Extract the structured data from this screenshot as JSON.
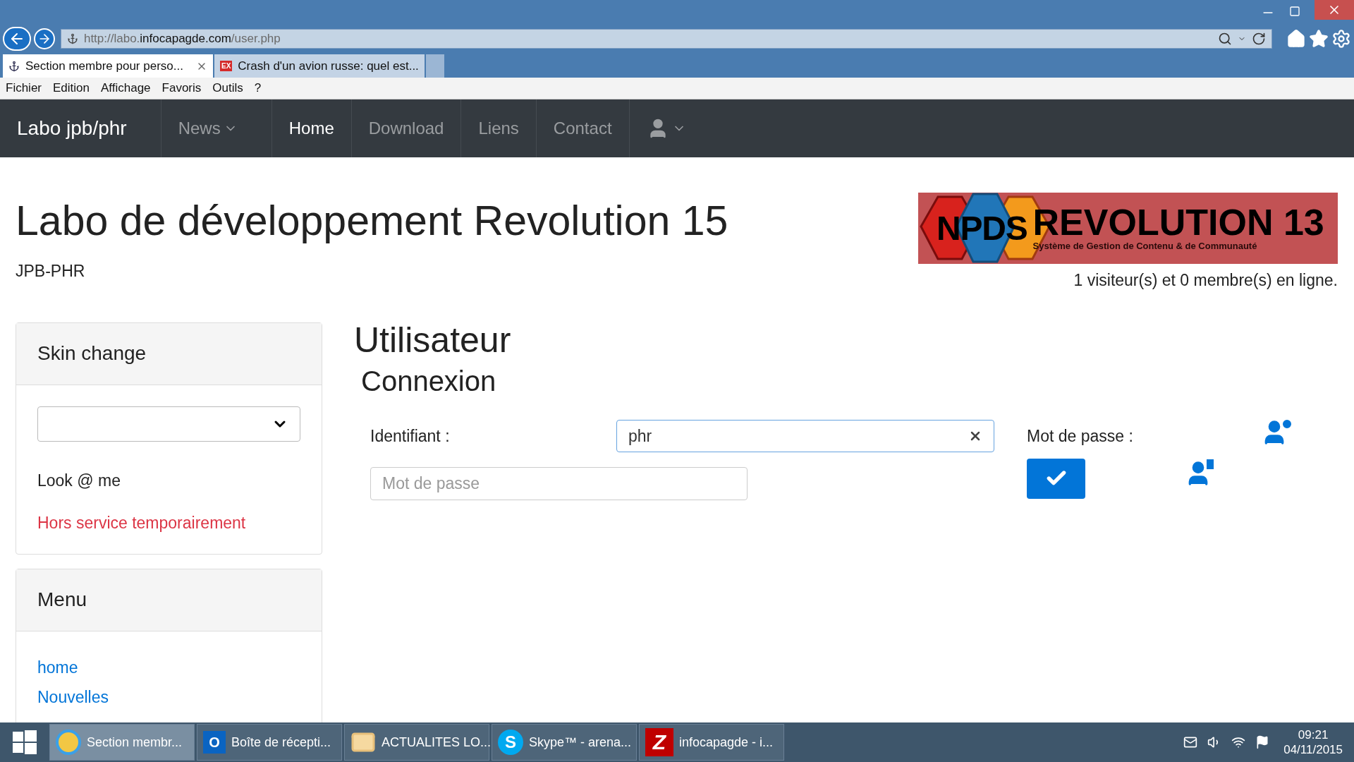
{
  "browser": {
    "address": {
      "prefix": "http://labo.",
      "domain": "infocapagde.com",
      "path": "/user.php"
    },
    "tabs": [
      {
        "label": "Section membre pour perso...",
        "selected": true,
        "kind": "anchor"
      },
      {
        "label": "Crash d'un avion russe: quel est...",
        "selected": false,
        "kind": "ex"
      }
    ],
    "ex_badge": "EX",
    "menu": [
      "Fichier",
      "Edition",
      "Affichage",
      "Favoris",
      "Outils",
      "?"
    ]
  },
  "navbar": {
    "brand": "Labo jpb/phr",
    "items": [
      {
        "label": "News",
        "dropdown": true,
        "selected": false
      },
      {
        "label": "Home",
        "dropdown": false,
        "selected": true
      },
      {
        "label": "Download",
        "dropdown": false,
        "selected": false
      },
      {
        "label": "Liens",
        "dropdown": false,
        "selected": false
      },
      {
        "label": "Contact",
        "dropdown": false,
        "selected": false
      }
    ]
  },
  "header": {
    "title": "Labo de développement Revolution 15",
    "subtitle": "JPB-PHR",
    "logo": {
      "npds": "NPDS",
      "name": "REVOLUTION 13",
      "tagline": "Système de Gestion de Contenu & de Communauté"
    },
    "online": "1 visiteur(s) et 0 membre(s) en ligne."
  },
  "sidebar": [
    {
      "title": "Skin change",
      "kind": "skin",
      "text": "Look @ me",
      "warning": "Hors service temporairement"
    },
    {
      "title": "Menu",
      "kind": "links",
      "links": [
        "home",
        "Nouvelles"
      ]
    }
  ],
  "main": {
    "title": "Utilisateur",
    "subtitle": "Connexion",
    "login_label": "Identifiant :",
    "login_value": "phr",
    "password_placeholder": "Mot de passe",
    "password_label": "Mot de passe :"
  },
  "taskbar": {
    "items": [
      {
        "label": "Section membr...",
        "kind": "ie",
        "selected": true
      },
      {
        "label": "Boîte de récepti...",
        "kind": "outlook",
        "selected": false
      },
      {
        "label": "ACTUALITES LO...",
        "kind": "mail",
        "selected": false
      },
      {
        "label": "Skype™ - arena...",
        "kind": "skype",
        "selected": false
      },
      {
        "label": "infocapagde - i...",
        "kind": "filezilla",
        "selected": false
      }
    ],
    "outlook_letter": "O",
    "skype_letter": "S",
    "filezilla_letter": "Z",
    "time": "09:21",
    "date": "04/11/2015"
  }
}
